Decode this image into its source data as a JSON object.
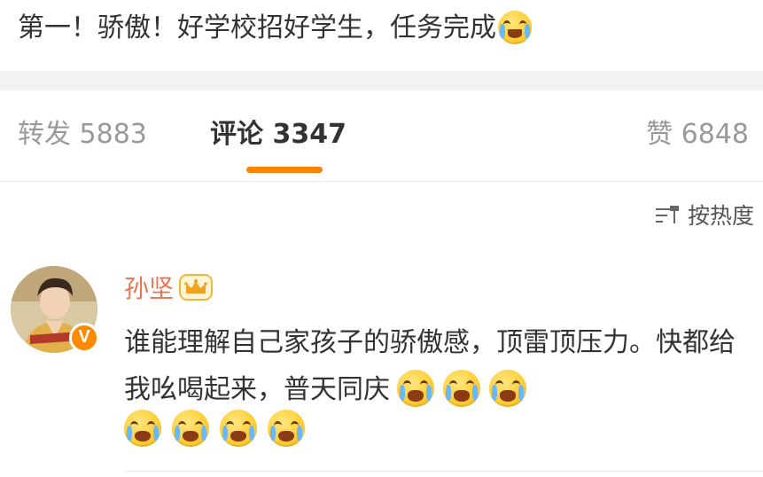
{
  "post": {
    "text": "第一！骄傲！好学校招好学生，任务完成",
    "emoji": "laugh-cry-emoji"
  },
  "tabs": {
    "repost": "转发 5883",
    "comments": "评论 3347",
    "likes": "赞 6848",
    "active": "comments",
    "accent_color": "#ff8200"
  },
  "sort": {
    "label": "按热度",
    "icon": "sort-icon"
  },
  "comment": {
    "username": "孙坚",
    "username_color": "#eb7350",
    "badge_icon": "crown-icon",
    "verified_icon": "verified-v-icon",
    "verified_label": "V",
    "text": "谁能理解自己家孩子的骄傲感，顶雷顶压力。快都给我吆喝起来，普天同庆",
    "emoji": "crying-emoji",
    "emoji_count_inline": 3,
    "emoji_count_row": 4
  }
}
